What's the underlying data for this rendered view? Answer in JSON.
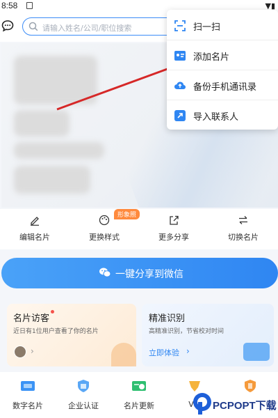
{
  "status_bar": {
    "time": "8:58"
  },
  "search": {
    "placeholder": "请输入姓名/公司/职位搜索"
  },
  "popup_menu": [
    {
      "label": "扫一扫",
      "icon": "scan-icon"
    },
    {
      "label": "添加名片",
      "icon": "add-card-icon"
    },
    {
      "label": "备份手机通讯录",
      "icon": "cloud-backup-icon"
    },
    {
      "label": "导入联系人",
      "icon": "import-contact-icon"
    }
  ],
  "actions": [
    {
      "label": "编辑名片",
      "icon": "edit-icon"
    },
    {
      "label": "更换样式",
      "icon": "palette-icon"
    },
    {
      "label": "更多分享",
      "icon": "share-icon"
    },
    {
      "label": "切换名片",
      "icon": "switch-icon"
    }
  ],
  "style_badge": "形象照",
  "share_button": {
    "label": "一键分享到微信"
  },
  "visitor_card": {
    "title": "名片访客",
    "subtitle": "近日有1位用户查看了你的名片",
    "chevron": "›"
  },
  "recognition_card": {
    "title": "精准识别",
    "subtitle": "高精准识别，节省校对时间",
    "link": "立即体验",
    "chevron": "›"
  },
  "bottom_nav": [
    {
      "label": "数字名片",
      "icon": "digital-card-icon"
    },
    {
      "label": "企业认证",
      "icon": "enterprise-cert-icon"
    },
    {
      "label": "名片更新",
      "icon": "card-update-icon"
    },
    {
      "label": "VIP",
      "icon": "vip-icon"
    },
    {
      "label": "",
      "icon": "shield-icon"
    }
  ],
  "watermark": {
    "text": "PCPOPT下载"
  },
  "colors": {
    "accent": "#2f86f2",
    "badge": "#ff8a3d",
    "arrow": "#d62828"
  }
}
